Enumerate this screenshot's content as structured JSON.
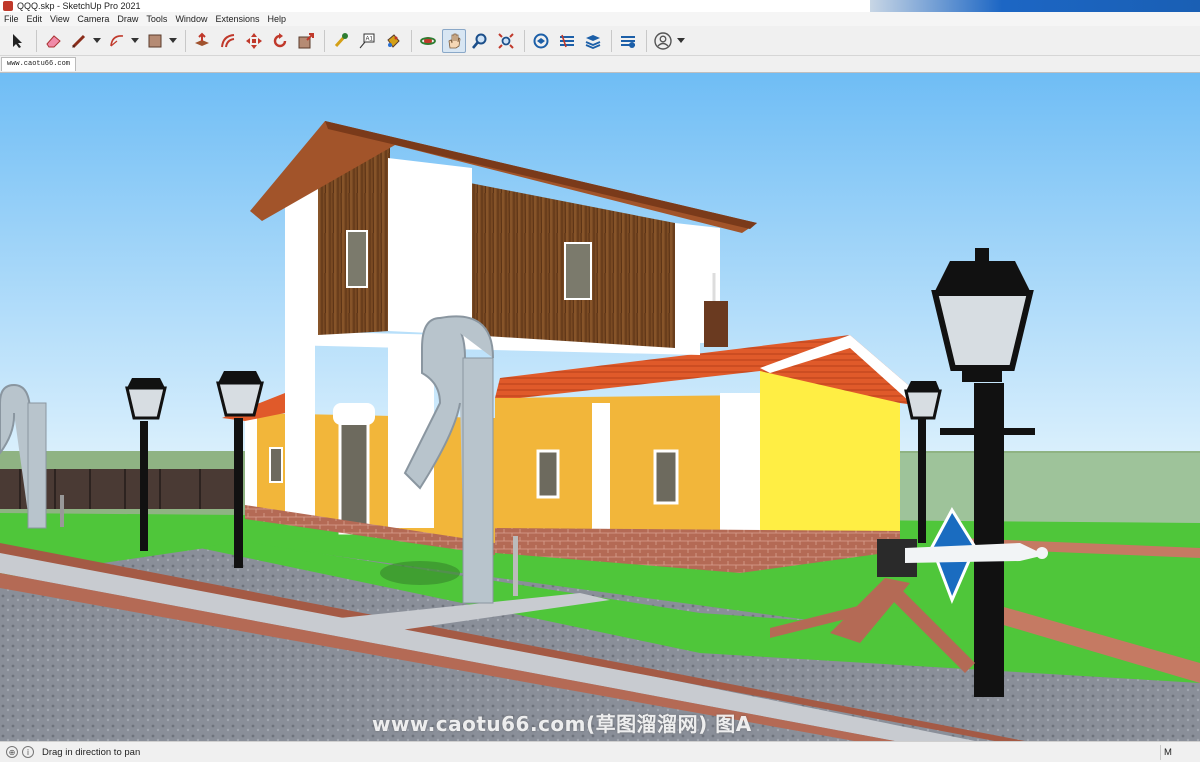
{
  "window": {
    "title": "QQQ.skp - SketchUp Pro 2021"
  },
  "menu": {
    "items": [
      "File",
      "Edit",
      "View",
      "Camera",
      "Draw",
      "Tools",
      "Window",
      "Extensions",
      "Help"
    ]
  },
  "toolbar": {
    "tools": [
      {
        "name": "select-icon",
        "active": false
      },
      {
        "name": "eraser-icon",
        "active": false
      },
      {
        "name": "line-icon",
        "active": false,
        "dropdown": true
      },
      {
        "name": "arc-icon",
        "active": false,
        "dropdown": true
      },
      {
        "name": "rectangle-icon",
        "active": false,
        "dropdown": true
      },
      {
        "name": "push-pull-icon",
        "active": false
      },
      {
        "name": "offset-icon",
        "active": false
      },
      {
        "name": "move-icon",
        "active": false
      },
      {
        "name": "rotate-icon",
        "active": false
      },
      {
        "name": "scale-icon",
        "active": false
      },
      {
        "name": "tape-measure-icon",
        "active": false
      },
      {
        "name": "text-icon",
        "active": false
      },
      {
        "name": "paint-bucket-icon",
        "active": false
      },
      {
        "name": "orbit-icon",
        "active": false
      },
      {
        "name": "pan-icon",
        "active": true
      },
      {
        "name": "zoom-icon",
        "active": false
      },
      {
        "name": "zoom-extents-icon",
        "active": false
      },
      {
        "name": "warehouse-icon",
        "active": false
      },
      {
        "name": "extension-warehouse-icon",
        "active": false
      },
      {
        "name": "layout-icon",
        "active": false
      },
      {
        "name": "extension-manager-icon",
        "active": false
      },
      {
        "name": "account-icon",
        "active": false,
        "dropdown": true
      }
    ]
  },
  "scene_tab": {
    "label": "www.caotu66.com"
  },
  "viewport": {
    "watermark": "www.caotu66.com(草图溜溜网) 图A",
    "sky_top": "#6fbdf5",
    "sky_bottom": "#dff2fd",
    "grass": "#4fc63a"
  },
  "status": {
    "hint": "Drag in direction to pan",
    "measure_label": "M"
  }
}
